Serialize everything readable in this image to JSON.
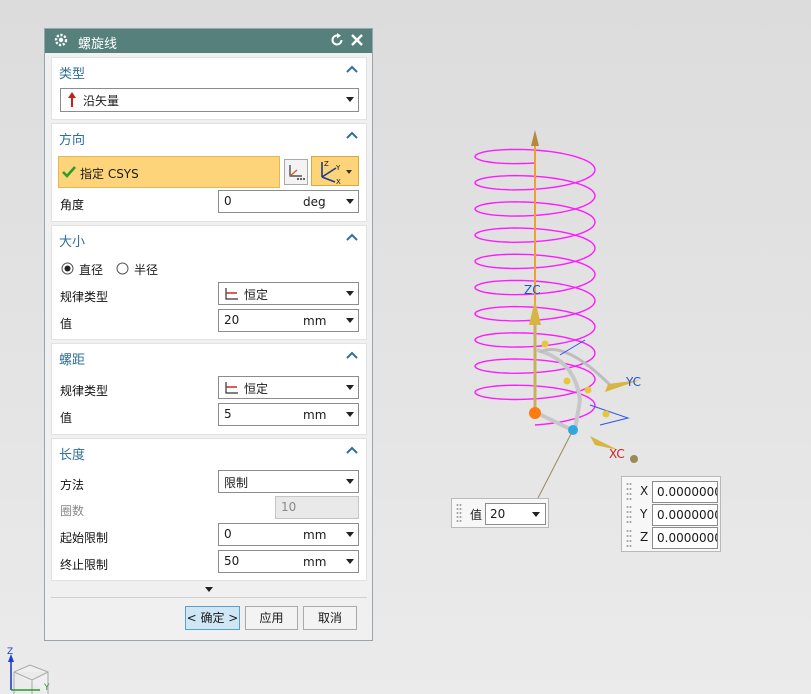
{
  "dialog": {
    "title": "螺旋线",
    "sections": {
      "type": {
        "title": "类型",
        "value": "沿矢量"
      },
      "direction": {
        "title": "方向",
        "csys_label": "指定 CSYS",
        "angle_label": "角度",
        "angle_value": "0",
        "angle_unit": "deg"
      },
      "size": {
        "title": "大小",
        "radio_diameter": "直径",
        "radio_radius": "半径",
        "law_label": "规律类型",
        "law_value": "恒定",
        "value_label": "值",
        "value": "20",
        "unit": "mm"
      },
      "pitch": {
        "title": "螺距",
        "law_label": "规律类型",
        "law_value": "恒定",
        "value_label": "值",
        "value": "5",
        "unit": "mm"
      },
      "length": {
        "title": "长度",
        "method_label": "方法",
        "method_value": "限制",
        "turns_label": "圈数",
        "turns_value": "10",
        "start_label": "起始限制",
        "start_value": "0",
        "start_unit": "mm",
        "end_label": "终止限制",
        "end_value": "50",
        "end_unit": "mm"
      }
    },
    "buttons": {
      "ok": "< 确定 >",
      "apply": "应用",
      "cancel": "取消"
    }
  },
  "viewport": {
    "axis_labels": {
      "zc": "ZC",
      "yc": "YC",
      "xc": "XC"
    },
    "value_popup": {
      "label": "值",
      "value": "20"
    },
    "coord_popup": {
      "x_label": "X",
      "x_value": "0.0000000",
      "y_label": "Y",
      "y_value": "0.0000000",
      "z_label": "Z",
      "z_value": "0.0000000"
    },
    "triad": {
      "z": "Z",
      "y": "Y"
    }
  },
  "colors": {
    "helix": "#ff1aff",
    "titlebar": "#56807c",
    "accent": "#2f6f98",
    "csys_bg": "#fdd47a"
  }
}
